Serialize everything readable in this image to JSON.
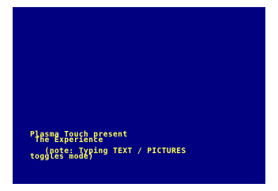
{
  "colors": {
    "screen_background": "#000080",
    "text": "#ffff55",
    "border": "#ffffff"
  },
  "screen": {
    "lines": [
      "Plasma Touch present",
      " The Experience",
      "   (note: Typing TEXT / PICTURES",
      "toggles mode)"
    ]
  }
}
